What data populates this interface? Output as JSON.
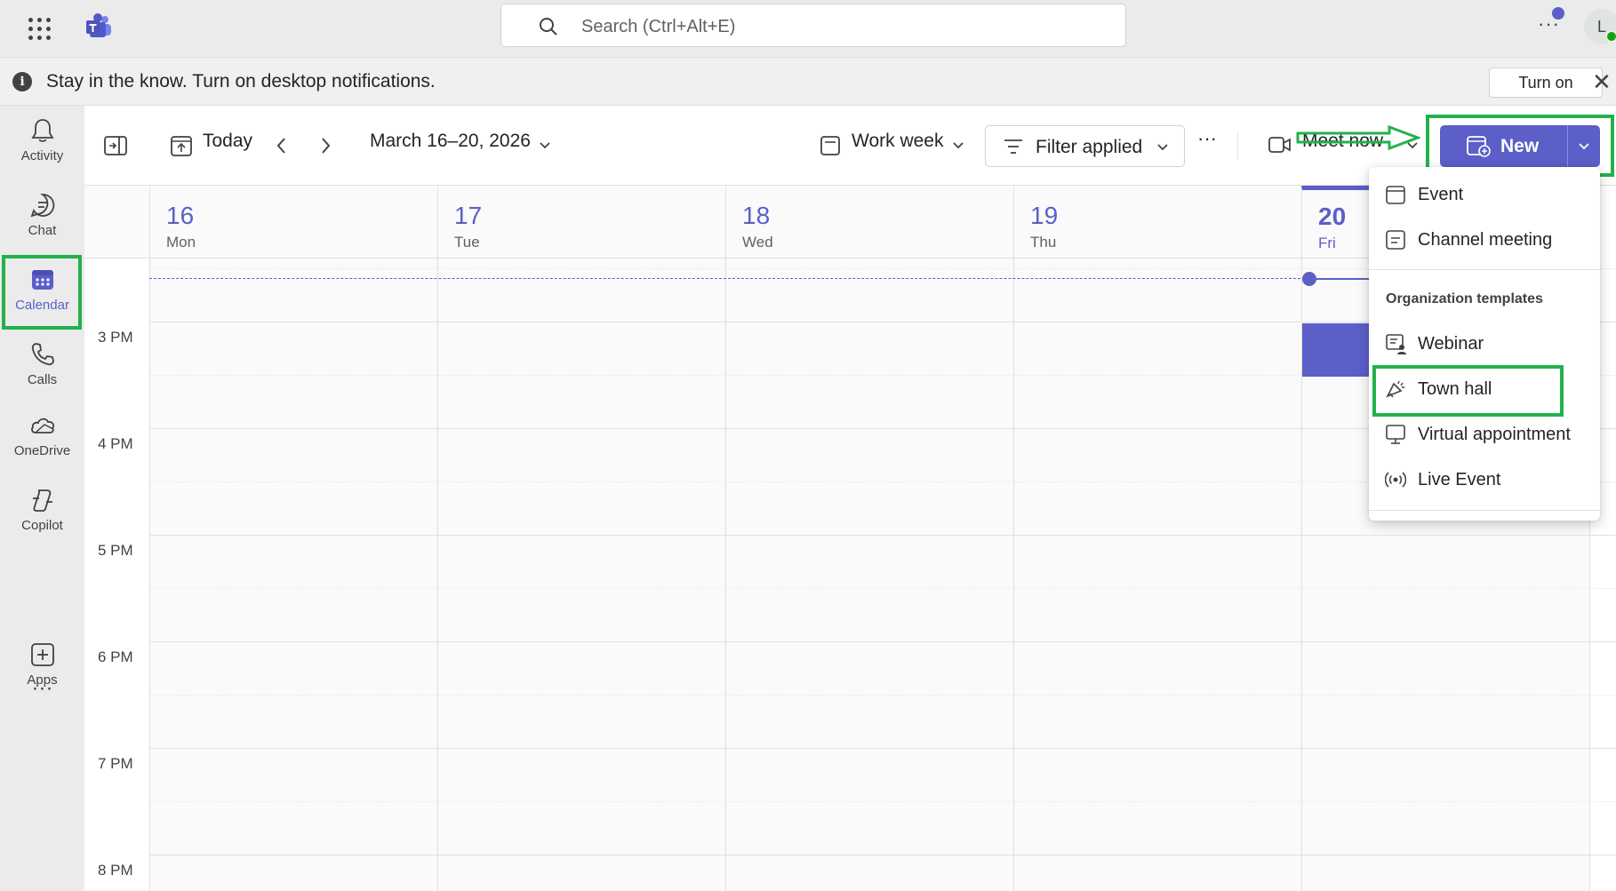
{
  "topbar": {
    "search_placeholder": "Search (Ctrl+Alt+E)",
    "more_label": "···",
    "avatar_initial": "L"
  },
  "notification": {
    "text": "Stay in the know. Turn on desktop notifications.",
    "turn_on_label": "Turn on",
    "close_label": "✕"
  },
  "rail": {
    "items": [
      {
        "label": "Activity",
        "icon": "bell-icon"
      },
      {
        "label": "Chat",
        "icon": "chat-icon"
      },
      {
        "label": "Calendar",
        "icon": "calendar-icon",
        "active": true
      },
      {
        "label": "Calls",
        "icon": "phone-icon"
      },
      {
        "label": "OneDrive",
        "icon": "cloud-icon"
      },
      {
        "label": "Copilot",
        "icon": "copilot-icon"
      },
      {
        "label": "Apps",
        "icon": "add-app-icon"
      }
    ],
    "more_label": "···"
  },
  "toolbar": {
    "today_label": "Today",
    "date_range": "March 16–20, 2026",
    "view_label": "Work week",
    "filter_label": "Filter applied",
    "more_label": "···",
    "meet_now_label": "Meet now",
    "new_label": "New"
  },
  "days": [
    {
      "num": "16",
      "name": "Mon"
    },
    {
      "num": "17",
      "name": "Tue"
    },
    {
      "num": "18",
      "name": "Wed"
    },
    {
      "num": "19",
      "name": "Thu"
    },
    {
      "num": "20",
      "name": "Fri",
      "today": true
    }
  ],
  "times": [
    "3 PM",
    "4 PM",
    "5 PM",
    "6 PM",
    "7 PM",
    "8 PM"
  ],
  "new_menu": {
    "items": [
      {
        "label": "Event",
        "icon": "calendar-event-icon"
      },
      {
        "label": "Channel meeting",
        "icon": "channel-meeting-icon"
      }
    ],
    "section_title": "Organization templates",
    "template_items": [
      {
        "label": "Webinar",
        "icon": "webinar-icon"
      },
      {
        "label": "Town hall",
        "icon": "megaphone-icon"
      },
      {
        "label": "Virtual appointment",
        "icon": "monitor-icon"
      },
      {
        "label": "Live Event",
        "icon": "broadcast-icon"
      }
    ]
  },
  "colors": {
    "accent": "#5b5fc7",
    "highlight": "#22b14c"
  }
}
